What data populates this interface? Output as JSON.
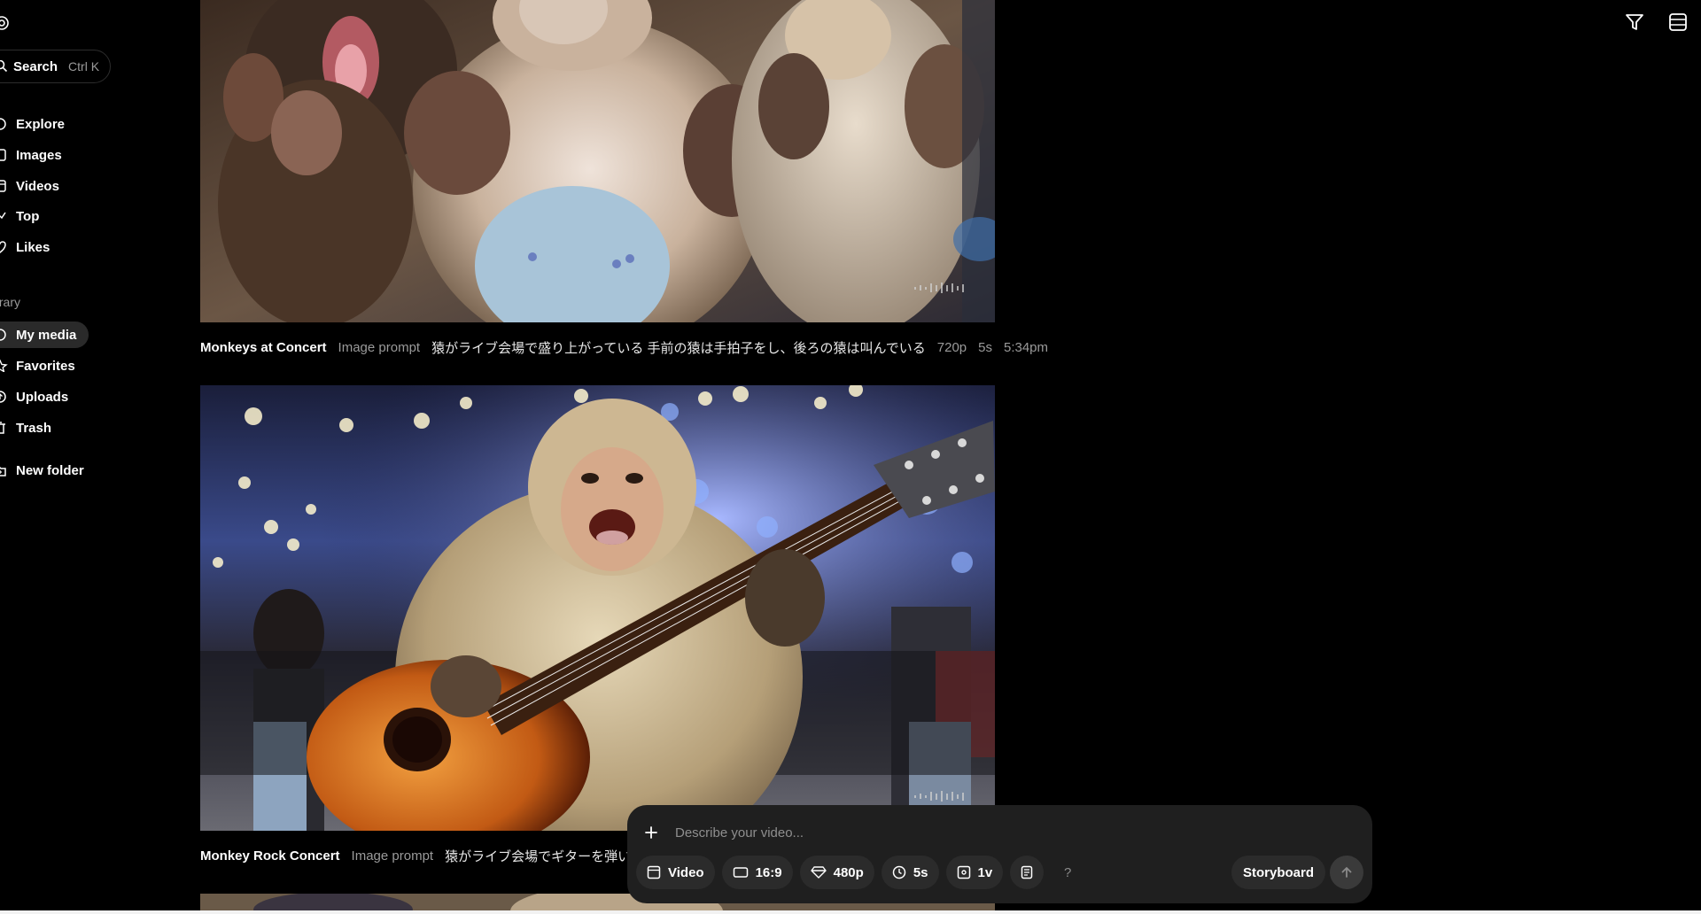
{
  "search": {
    "label": "Search",
    "shortcut": "Ctrl K"
  },
  "nav": {
    "items": [
      {
        "label": "Explore",
        "icon": "compass-icon"
      },
      {
        "label": "Images",
        "icon": "image-icon"
      },
      {
        "label": "Videos",
        "icon": "video-icon"
      },
      {
        "label": "Top",
        "icon": "trending-icon"
      },
      {
        "label": "Likes",
        "icon": "heart-icon"
      }
    ],
    "library_label": "ibrary",
    "library_items": [
      {
        "label": "My media",
        "icon": "media-icon",
        "active": true
      },
      {
        "label": "Favorites",
        "icon": "star-icon"
      },
      {
        "label": "Uploads",
        "icon": "upload-icon"
      },
      {
        "label": "Trash",
        "icon": "trash-icon"
      }
    ],
    "new_folder": "New folder"
  },
  "feed": [
    {
      "title": "Monkeys at Concert",
      "type": "Image prompt",
      "prompt": "猿がライブ会場で盛り上がっている 手前の猿は手拍子をし、後ろの猿は叫んでいる",
      "resolution": "720p",
      "duration": "5s",
      "time": "5:34pm"
    },
    {
      "title": "Monkey Rock Concert",
      "type": "Image prompt",
      "prompt": "猿がライブ会場でギターを弾いている"
    }
  ],
  "composer": {
    "placeholder": "Describe your video...",
    "chips": {
      "mode": "Video",
      "aspect": "16:9",
      "quality": "480p",
      "duration": "5s",
      "variations": "1v",
      "help": "?"
    },
    "storyboard": "Storyboard"
  },
  "colors": {
    "background": "#000000",
    "panel": "#1f1f1f",
    "chip": "#2b2b2b",
    "muted": "#9a9a9a"
  }
}
